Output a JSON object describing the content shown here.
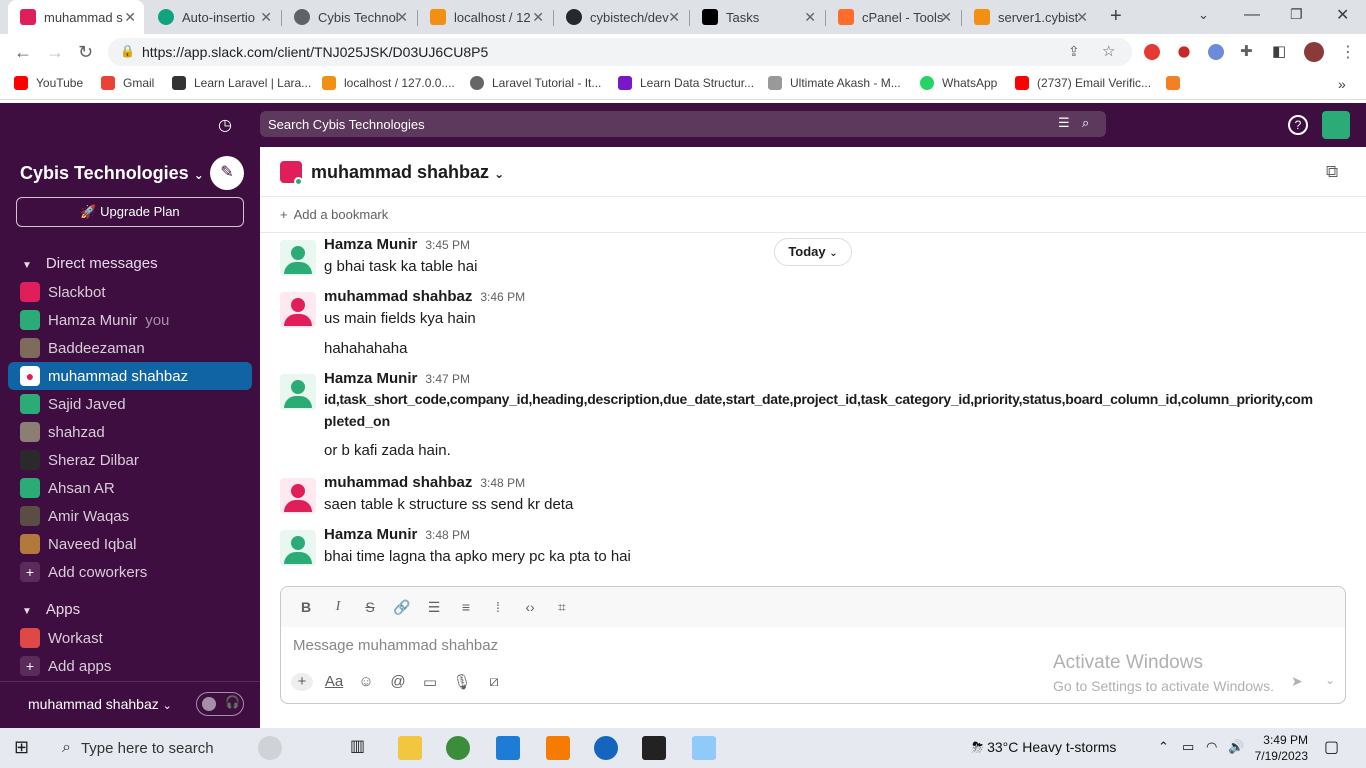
{
  "tabs": [
    {
      "title": "muhammad s",
      "color": "#e01e5a",
      "active": true
    },
    {
      "title": "Auto-insertio",
      "color": "#10a37f"
    },
    {
      "title": "Cybis Technol",
      "color": "#5f6368"
    },
    {
      "title": "localhost / 12",
      "color": "#f29111"
    },
    {
      "title": "cybistech/dev",
      "color": "#24292f"
    },
    {
      "title": "Tasks",
      "color": "#000000"
    },
    {
      "title": "cPanel - Tools",
      "color": "#ff6c2c"
    },
    {
      "title": "server1.cybist",
      "color": "#f29111"
    }
  ],
  "address": {
    "url": "https://app.slack.com/client/TNJ025JSK/D03UJ6CU8P5"
  },
  "bookmarks": [
    {
      "label": "YouTube",
      "color": "#ff0000"
    },
    {
      "label": "Gmail",
      "color": "#ea4335"
    },
    {
      "label": "Learn Laravel | Lara...",
      "color": "#333333"
    },
    {
      "label": "localhost / 127.0.0....",
      "color": "#f29111"
    },
    {
      "label": "Laravel Tutorial - It...",
      "color": "#666666"
    },
    {
      "label": "Learn Data Structur...",
      "color": "#7a18c9"
    },
    {
      "label": "Ultimate Akash - M...",
      "color": "#999999"
    },
    {
      "label": "WhatsApp",
      "color": "#25d366"
    },
    {
      "label": "(2737) Email Verific...",
      "color": "#ff0000"
    }
  ],
  "slack": {
    "search_placeholder": "Search Cybis Technologies",
    "workspace": "Cybis Technologies",
    "upgrade": "Upgrade Plan",
    "direct_messages": "Direct messages",
    "dms": [
      {
        "name": "Slackbot",
        "color": "#e01e5a"
      },
      {
        "name": "Hamza Munir",
        "you": "you",
        "color": "#2bac76"
      },
      {
        "name": "Baddeezaman",
        "color": "#7d6b5c"
      },
      {
        "name": "muhammad shahbaz",
        "color": "#e01e5a",
        "selected": true
      },
      {
        "name": "Sajid Javed",
        "color": "#2bac76"
      },
      {
        "name": "shahzad",
        "color": "#8a7f72"
      },
      {
        "name": "Sheraz Dilbar",
        "color": "#2a2a2a"
      },
      {
        "name": "Ahsan AR",
        "color": "#2bac76"
      },
      {
        "name": "Amir Waqas",
        "color": "#5a4e44"
      },
      {
        "name": "Naveed Iqbal",
        "color": "#b2783c"
      }
    ],
    "add_coworkers": "Add coworkers",
    "apps": "Apps",
    "app_items": [
      {
        "name": "Workast"
      }
    ],
    "add_apps": "Add apps",
    "current_user": "muhammad shahbaz"
  },
  "channel": {
    "name": "muhammad shahbaz",
    "add_bookmark": "Add a bookmark",
    "today": "Today",
    "messages": [
      {
        "author": "Hamza Munir",
        "time": "3:45 PM",
        "text": "g bhai task ka table hai",
        "color": "#2bac76"
      },
      {
        "author": "muhammad shahbaz",
        "time": "3:46 PM",
        "text": "us main fields kya hain",
        "extra": "hahahahaha",
        "color": "#e01e5a"
      },
      {
        "author": "Hamza Munir",
        "time": "3:47 PM",
        "text1": "id,task_short_code,company_id,heading,description,due_date,start_date,project_id,task_category_id,priority,status,board_column_id,column_priority,com",
        "text2": "pleted_on",
        "extra": "or b kafi zada hain.",
        "color": "#2bac76"
      },
      {
        "author": "muhammad shahbaz",
        "time": "3:48 PM",
        "text": "saen table k structure ss send kr deta",
        "color": "#e01e5a"
      },
      {
        "author": "Hamza Munir",
        "time": "3:48 PM",
        "text": "bhai time lagna tha apko mery pc ka pta to hai",
        "color": "#2bac76"
      }
    ],
    "composer_placeholder": "Message muhammad shahbaz"
  },
  "activate": {
    "title": "Activate Windows",
    "subtitle": "Go to Settings to activate Windows."
  },
  "taskbar": {
    "search": "Type here to search",
    "weather": "33°C  Heavy t-storms",
    "time": "3:49 PM",
    "date": "7/19/2023"
  }
}
